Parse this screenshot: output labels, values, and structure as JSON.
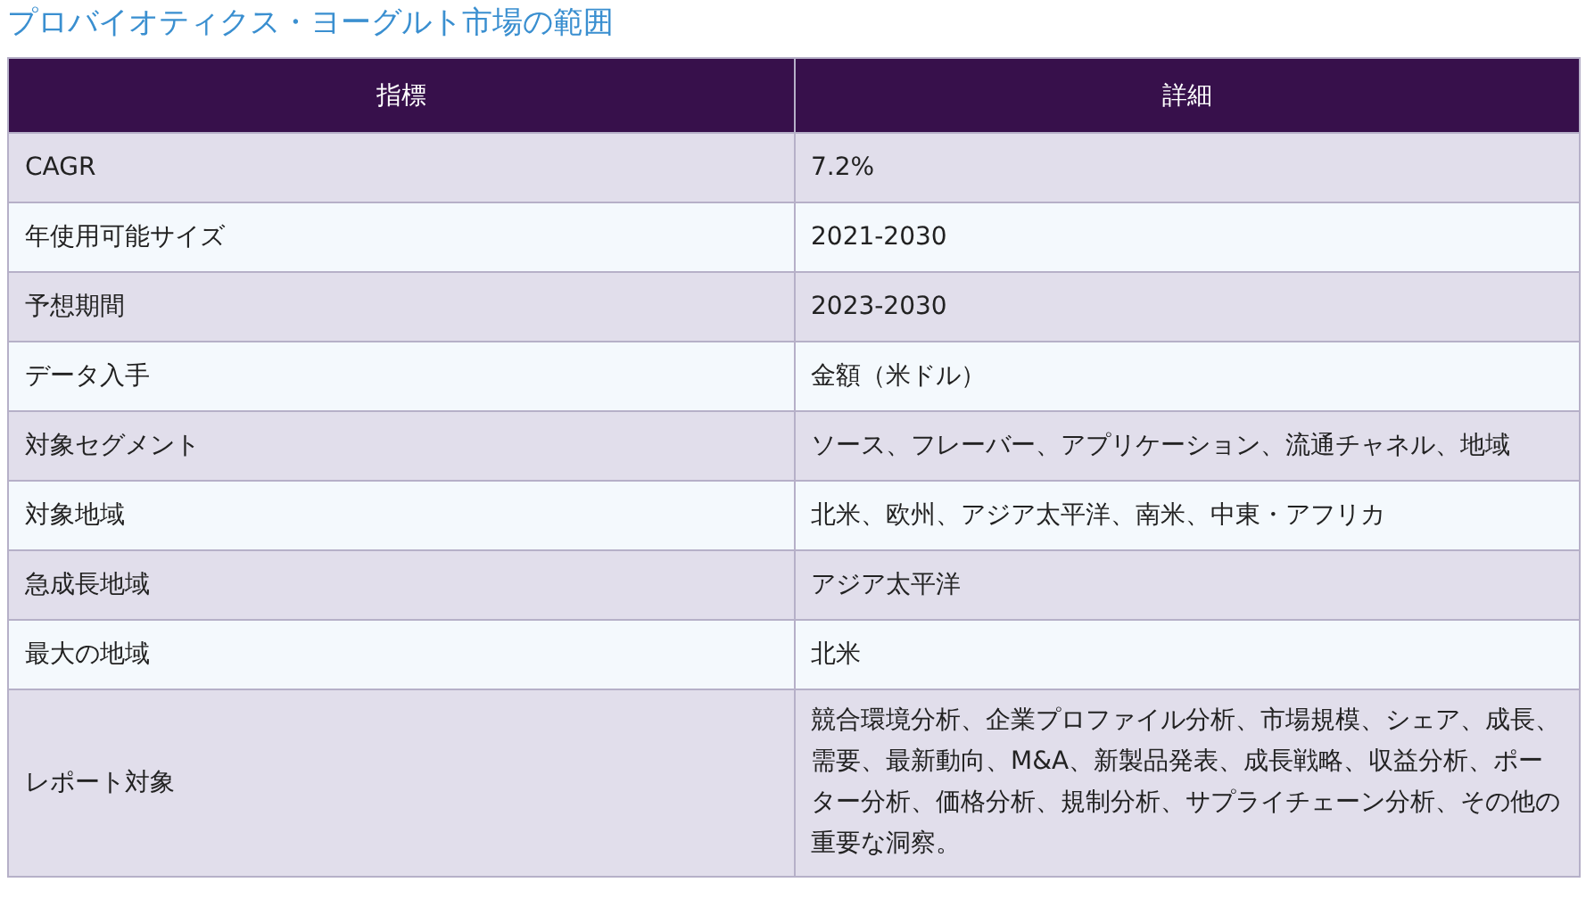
{
  "title": "プロバイオティクス・ヨーグルト市場の範囲",
  "table": {
    "columns": [
      "指標",
      "詳細"
    ],
    "rows": [
      [
        "CAGR",
        "7.2%"
      ],
      [
        "年使用可能サイズ",
        "2021-2030"
      ],
      [
        "予想期間",
        "2023-2030"
      ],
      [
        "データ入手",
        "金額（米ドル）"
      ],
      [
        "対象セグメント",
        "ソース、フレーバー、アプリケーション、流通チャネル、地域"
      ],
      [
        "対象地域",
        "北米、欧州、アジア太平洋、南米、中東・アフリカ"
      ],
      [
        "急成長地域",
        "アジア太平洋"
      ],
      [
        "最大の地域",
        "北米"
      ],
      [
        "レポート対象",
        "競合環境分析、企業プロファイル分析、市場規模、シェア、成長、需要、最新動向、M&A、新製品発表、成長戦略、収益分析、ポーター分析、価格分析、規制分析、サプライチェーン分析、その他の重要な洞察。"
      ]
    ]
  }
}
